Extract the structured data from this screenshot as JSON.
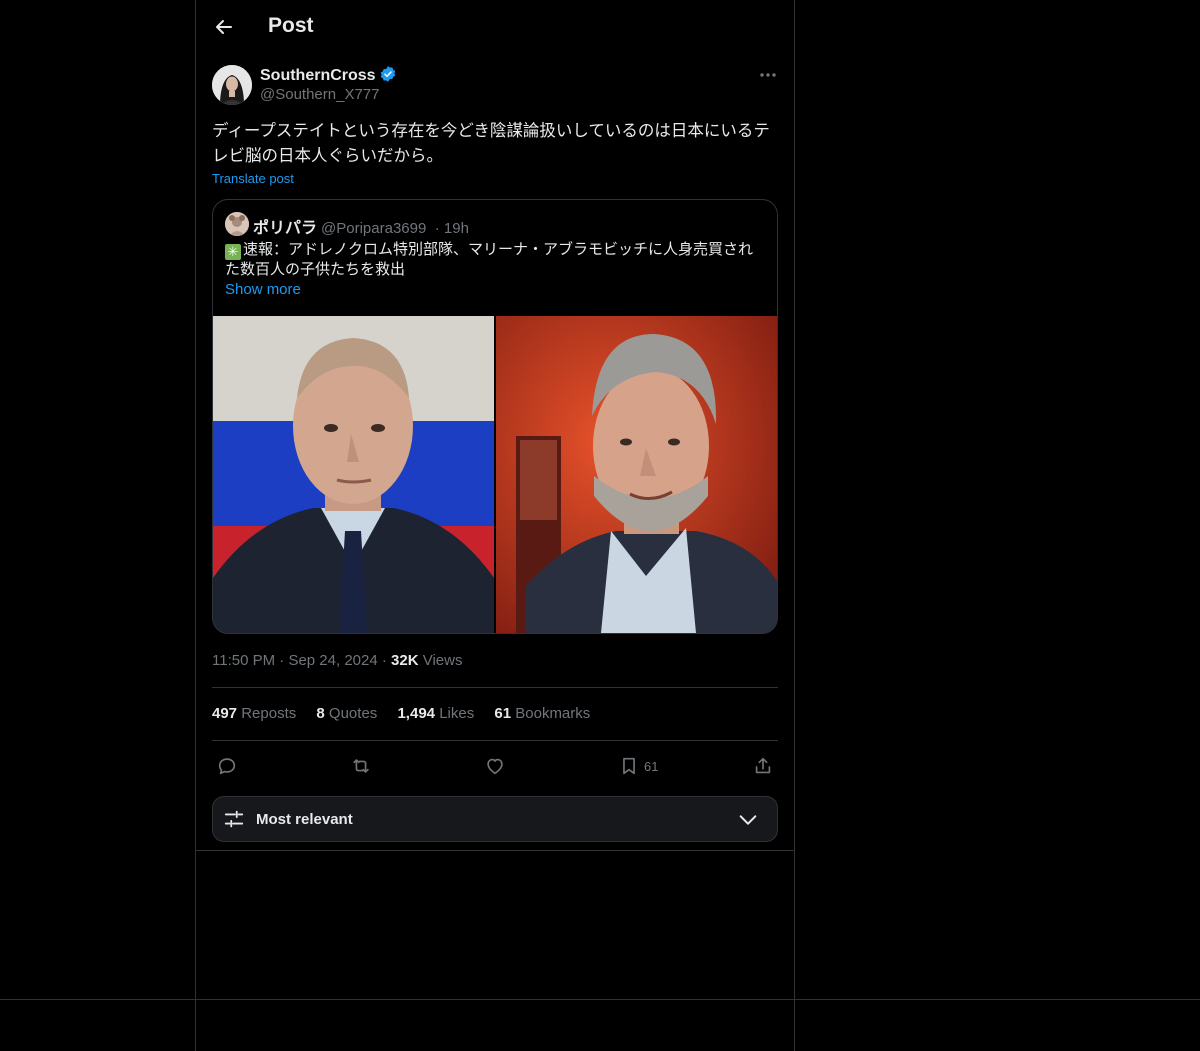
{
  "header": {
    "title": "Post"
  },
  "author": {
    "name": "SouthernCross",
    "handle": "@Southern_X777"
  },
  "post": {
    "text": "ディープステイトという存在を今どき陰謀論扱いしているのは日本にいるテレビ脳の日本人ぐらいだから。",
    "translate_label": "Translate post"
  },
  "quote": {
    "name": "ポリパラ",
    "handle": "@Poripara3699",
    "time": "· 19h",
    "emoji": "✳",
    "text": "速報：アドレノクロム特別部隊、マリーナ・アブラモビッチに人身売買された数百人の子供たちを救出",
    "show_more": "Show more"
  },
  "meta": {
    "time": "11:50 PM",
    "date": "Sep 24, 2024",
    "views_count": "32K",
    "views_label": "Views"
  },
  "stats": {
    "reposts": {
      "count": "497",
      "label": "Reposts"
    },
    "quotes": {
      "count": "8",
      "label": "Quotes"
    },
    "likes": {
      "count": "1,494",
      "label": "Likes"
    },
    "bookmarks": {
      "count": "61",
      "label": "Bookmarks"
    }
  },
  "actions": {
    "bookmark_count": "61"
  },
  "sort": {
    "label": "Most relevant"
  },
  "colors": {
    "accent": "#1d9bf0",
    "background": "#000000",
    "border": "#2f3336",
    "muted": "#71767b",
    "text": "#e7e9ea"
  }
}
